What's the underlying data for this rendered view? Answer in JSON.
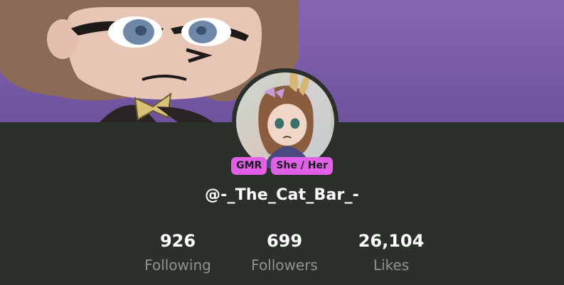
{
  "profile": {
    "username": "@-_The_Cat_Bar_-",
    "tags": [
      "GMR",
      "She / Her"
    ]
  },
  "stats": {
    "following": {
      "value": "926",
      "label": "Following"
    },
    "followers": {
      "value": "699",
      "label": "Followers"
    },
    "likes": {
      "value": "26,104",
      "label": "Likes"
    }
  },
  "colors": {
    "background": "#2b302b",
    "banner": "#7a5ea8",
    "tag": "#e060e8",
    "label_gray": "#8e938e"
  }
}
